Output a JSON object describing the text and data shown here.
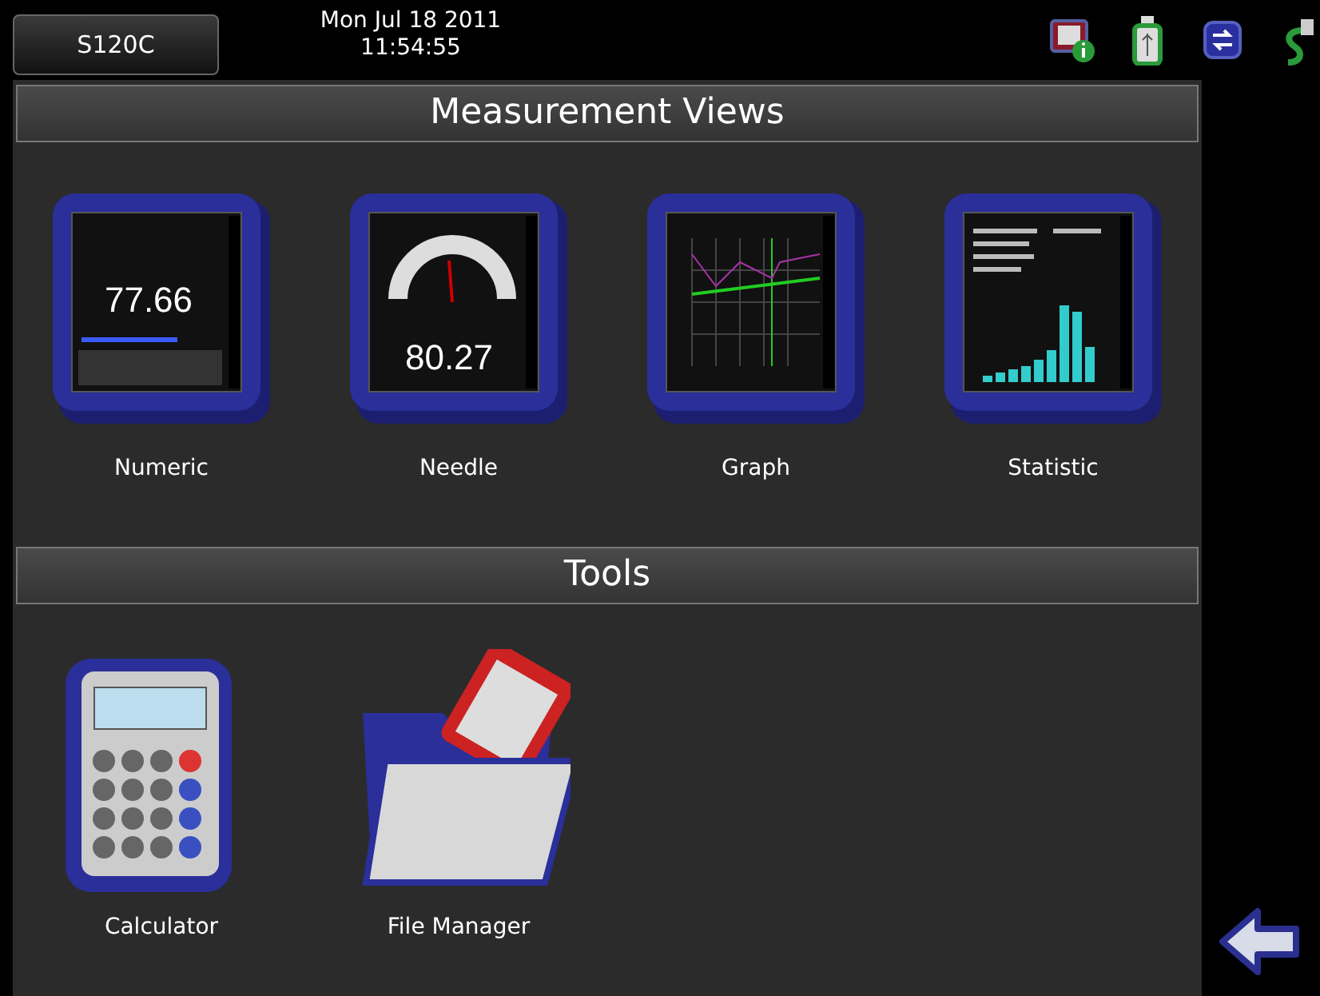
{
  "top_bar": {
    "device_button": "S120C",
    "date": "Mon Jul 18 2011",
    "time": "11:54:55"
  },
  "sections": [
    {
      "title": "Measurement Views",
      "items": [
        {
          "label": "Numeric",
          "kind": "numeric",
          "reading": "77.66"
        },
        {
          "label": "Needle",
          "kind": "needle",
          "reading": "80.27"
        },
        {
          "label": "Graph",
          "kind": "graph"
        },
        {
          "label": "Statistic",
          "kind": "statistic"
        }
      ]
    },
    {
      "title": "Tools",
      "items": [
        {
          "label": "Calculator",
          "kind": "calculator"
        },
        {
          "label": "File Manager",
          "kind": "file_manager"
        }
      ]
    }
  ]
}
